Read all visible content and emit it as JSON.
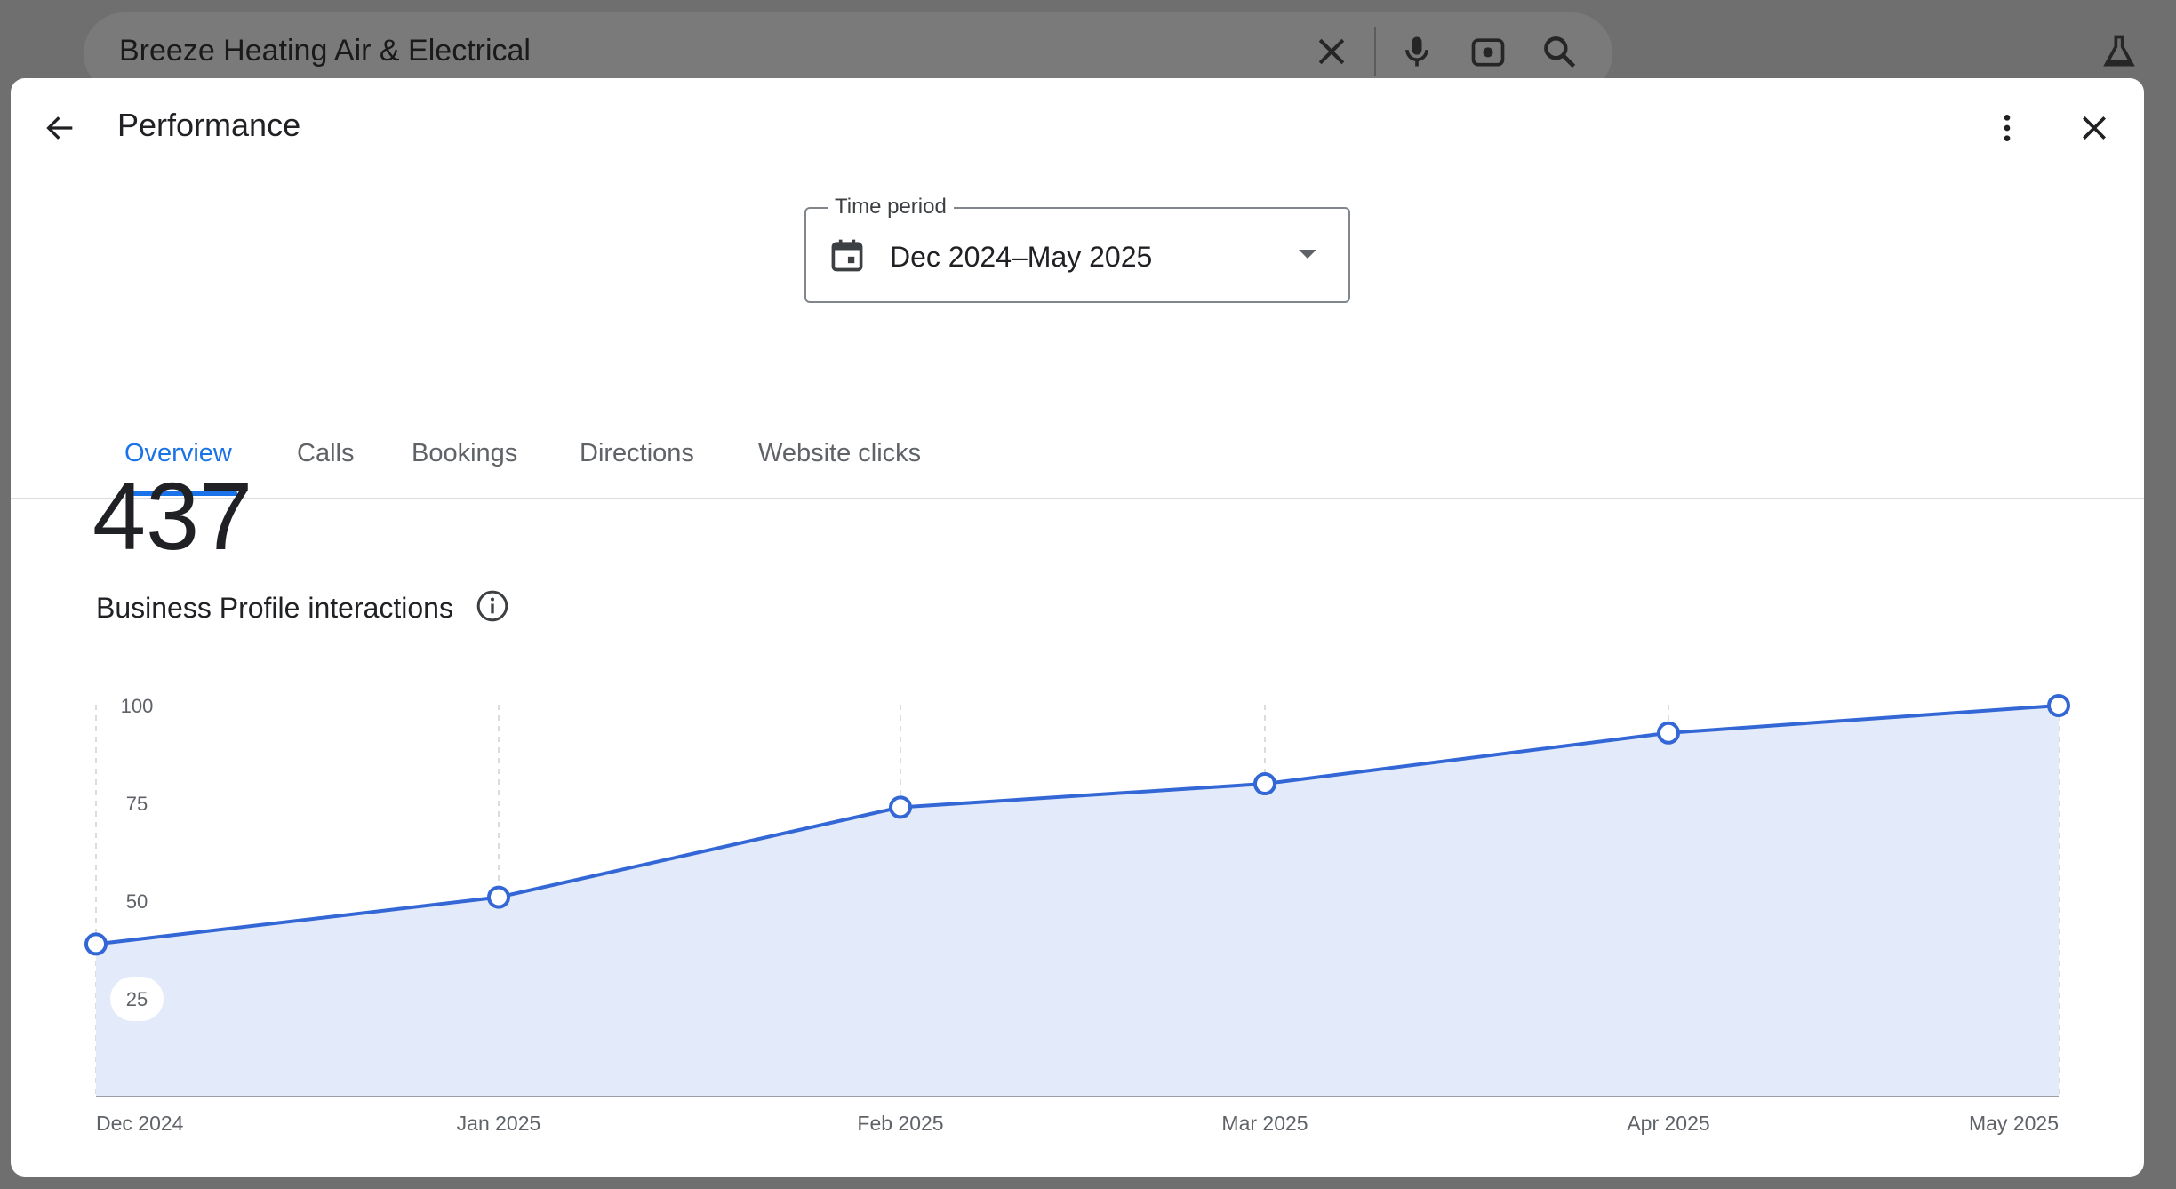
{
  "search": {
    "query": "Breeze Heating Air & Electrical"
  },
  "dialog": {
    "title": "Performance",
    "time_period": {
      "label": "Time period",
      "value": "Dec 2024–May 2025"
    },
    "tabs": [
      {
        "label": "Overview",
        "active": true
      },
      {
        "label": "Calls",
        "active": false
      },
      {
        "label": "Bookings",
        "active": false
      },
      {
        "label": "Directions",
        "active": false
      },
      {
        "label": "Website clicks",
        "active": false
      }
    ],
    "metric": {
      "value": "437",
      "label": "Business Profile interactions"
    }
  },
  "colors": {
    "accent": "#1a73e8",
    "line": "#3367d6",
    "area_fill": "#e3eafa"
  },
  "chart_data": {
    "type": "area",
    "categories": [
      "Dec 2024",
      "Jan 2025",
      "Feb 2025",
      "Mar 2025",
      "Apr 2025",
      "May 2025"
    ],
    "values": [
      39,
      51,
      74,
      80,
      93,
      100
    ],
    "y_ticks": [
      100,
      75,
      50,
      25
    ],
    "ylim": [
      0,
      100
    ],
    "grid": "vertical-dashed",
    "title": "",
    "xlabel": "",
    "ylabel": ""
  }
}
